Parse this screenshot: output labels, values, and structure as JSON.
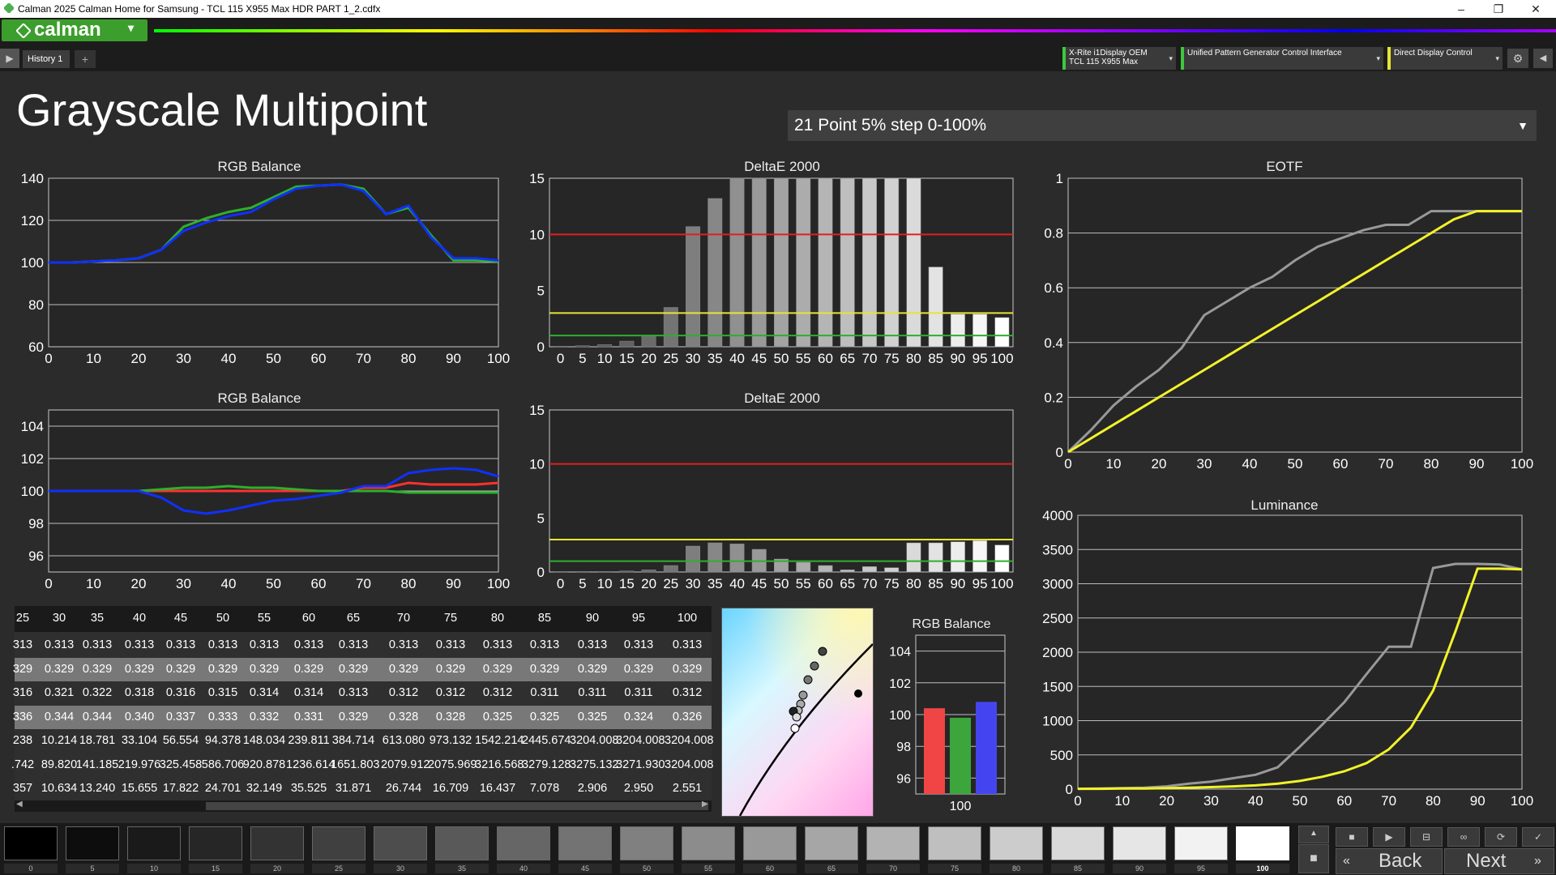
{
  "window": {
    "title": "Calman 2025 Calman Home for Samsung  - TCL 115 X955 Max HDR PART 1_2.cdfx",
    "min": "–",
    "max": "❐",
    "close": "✕"
  },
  "app": {
    "logo": "calman"
  },
  "tabs": [
    {
      "label": "History 1"
    }
  ],
  "devices": {
    "meter": {
      "line1": "X-Rite i1Display OEM",
      "line2": "TCL 115 X955 Max"
    },
    "generator": {
      "label": "Unified Pattern Generator Control Interface"
    },
    "display": {
      "label": "Direct Display Control"
    }
  },
  "page": {
    "title": "Grayscale Multipoint",
    "preset": "21 Point 5% step 0-100%"
  },
  "charts": {
    "rgb_top": "RGB Balance",
    "de_top": "DeltaE 2000",
    "rgb_bottom": "RGB Balance",
    "de_bottom": "DeltaE 2000",
    "eotf": "EOTF",
    "lum": "Luminance",
    "rgb_small": "RGB Balance"
  },
  "chart_data": [
    {
      "type": "line",
      "title": "RGB Balance",
      "x": [
        0,
        5,
        10,
        15,
        20,
        25,
        30,
        35,
        40,
        45,
        50,
        55,
        60,
        65,
        70,
        75,
        80,
        85,
        90,
        95,
        100
      ],
      "ylim": [
        60,
        140
      ],
      "series": [
        {
          "color": "#2cb02c",
          "values": [
            100,
            100,
            100.5,
            101,
            102,
            106,
            117,
            121,
            124,
            126,
            131,
            136,
            136.5,
            137,
            135,
            123,
            126,
            113,
            101,
            101,
            100.5
          ]
        },
        {
          "color": "#1030ff",
          "values": [
            100,
            100,
            100.5,
            101,
            102,
            106,
            115,
            119,
            122,
            124,
            130,
            135,
            136.5,
            137,
            134,
            123,
            127,
            112,
            102,
            102,
            101
          ]
        }
      ]
    },
    {
      "type": "bar",
      "title": "DeltaE 2000",
      "categories": [
        "0",
        "5",
        "10",
        "15",
        "20",
        "25",
        "30",
        "35",
        "40",
        "45",
        "50",
        "55",
        "60",
        "65",
        "70",
        "75",
        "80",
        "85",
        "90",
        "95",
        "100"
      ],
      "ylim": [
        0,
        15
      ],
      "values": [
        0.05,
        0.1,
        0.2,
        0.5,
        1.0,
        3.5,
        10.7,
        13.2,
        15,
        15,
        15,
        15,
        15,
        15,
        15,
        15,
        15,
        7.1,
        2.9,
        2.9,
        2.6
      ],
      "lines": [
        10,
        3,
        1
      ]
    },
    {
      "type": "line",
      "title": "RGB Balance",
      "x": [
        0,
        5,
        10,
        15,
        20,
        25,
        30,
        35,
        40,
        45,
        50,
        55,
        60,
        65,
        70,
        75,
        80,
        85,
        90,
        95,
        100
      ],
      "ylim": [
        95,
        105
      ],
      "series": [
        {
          "color": "#ff3030",
          "values": [
            100,
            100,
            100,
            100,
            100,
            100,
            100,
            100,
            100,
            100,
            100,
            100,
            100,
            100,
            100.2,
            100.2,
            100.5,
            100.4,
            100.4,
            100.4,
            100.5
          ]
        },
        {
          "color": "#2cb02c",
          "values": [
            100,
            100,
            100,
            100,
            100,
            100.1,
            100.2,
            100.2,
            100.3,
            100.2,
            100.2,
            100.1,
            100,
            100,
            100,
            100,
            99.9,
            99.9,
            99.9,
            99.9,
            99.9
          ]
        },
        {
          "color": "#1030ff",
          "values": [
            100,
            100,
            100,
            100,
            100,
            99.6,
            98.8,
            98.6,
            98.8,
            99.1,
            99.4,
            99.5,
            99.7,
            99.9,
            100.3,
            100.3,
            101.1,
            101.3,
            101.4,
            101.3,
            100.9
          ]
        }
      ]
    },
    {
      "type": "bar",
      "title": "DeltaE 2000",
      "categories": [
        "0",
        "5",
        "10",
        "15",
        "20",
        "25",
        "30",
        "35",
        "40",
        "45",
        "50",
        "55",
        "60",
        "65",
        "70",
        "75",
        "80",
        "85",
        "90",
        "95",
        "100"
      ],
      "ylim": [
        0,
        15
      ],
      "values": [
        0.05,
        0.05,
        0.05,
        0.1,
        0.2,
        0.6,
        2.4,
        2.7,
        2.6,
        2.1,
        1.2,
        0.9,
        0.6,
        0.2,
        0.5,
        0.4,
        2.7,
        2.7,
        2.8,
        2.9,
        2.5
      ],
      "lines": [
        10,
        3,
        1
      ]
    },
    {
      "type": "line",
      "title": "EOTF",
      "x": [
        0,
        5,
        10,
        15,
        20,
        25,
        30,
        35,
        40,
        45,
        50,
        55,
        60,
        65,
        70,
        75,
        80,
        85,
        90,
        95,
        100
      ],
      "ylim": [
        0,
        1
      ],
      "series": [
        {
          "color": "#999999",
          "values": [
            0,
            0.08,
            0.17,
            0.24,
            0.3,
            0.38,
            0.5,
            0.55,
            0.6,
            0.64,
            0.7,
            0.75,
            0.78,
            0.81,
            0.83,
            0.83,
            0.88,
            0.88,
            0.88,
            0.88,
            0.88
          ]
        },
        {
          "color": "#f2f22a",
          "values": [
            0,
            0.05,
            0.1,
            0.15,
            0.2,
            0.25,
            0.3,
            0.35,
            0.4,
            0.45,
            0.5,
            0.55,
            0.6,
            0.65,
            0.7,
            0.75,
            0.8,
            0.85,
            0.88,
            0.88,
            0.88
          ]
        }
      ]
    },
    {
      "type": "line",
      "title": "Luminance",
      "x": [
        0,
        5,
        10,
        15,
        20,
        25,
        30,
        35,
        40,
        45,
        50,
        55,
        60,
        65,
        70,
        75,
        80,
        85,
        90,
        95,
        100
      ],
      "ylim": [
        0,
        4000
      ],
      "series": [
        {
          "color": "#999999",
          "values": [
            5,
            10,
            15,
            20,
            40,
            80,
            110,
            160,
            210,
            320,
            620,
            940,
            1270,
            1680,
            2080,
            2080,
            3230,
            3290,
            3290,
            3280,
            3210
          ]
        },
        {
          "color": "#f2f22a",
          "values": [
            5,
            5,
            10,
            10,
            15,
            20,
            30,
            40,
            55,
            80,
            120,
            180,
            260,
            380,
            580,
            900,
            1440,
            2300,
            3220,
            3220,
            3210
          ]
        }
      ]
    },
    {
      "type": "bar",
      "title": "RGB Balance",
      "categories": [
        "100"
      ],
      "ylim": [
        95,
        105
      ],
      "series": [
        {
          "color": "#f04545",
          "values": [
            100.4
          ]
        },
        {
          "color": "#3ca63c",
          "values": [
            99.8
          ]
        },
        {
          "color": "#4545f0",
          "values": [
            100.8
          ]
        }
      ]
    }
  ],
  "table": {
    "headers": [
      "25",
      "30",
      "35",
      "40",
      "45",
      "50",
      "55",
      "60",
      "65",
      "70",
      "75",
      "80",
      "85",
      "90",
      "95",
      "100"
    ],
    "rows": [
      [
        "313",
        "0.313",
        "0.313",
        "0.313",
        "0.313",
        "0.313",
        "0.313",
        "0.313",
        "0.313",
        "0.313",
        "0.313",
        "0.313",
        "0.313",
        "0.313",
        "0.313",
        "0.313"
      ],
      [
        "329",
        "0.329",
        "0.329",
        "0.329",
        "0.329",
        "0.329",
        "0.329",
        "0.329",
        "0.329",
        "0.329",
        "0.329",
        "0.329",
        "0.329",
        "0.329",
        "0.329",
        "0.329"
      ],
      [
        "316",
        "0.321",
        "0.322",
        "0.318",
        "0.316",
        "0.315",
        "0.314",
        "0.314",
        "0.313",
        "0.312",
        "0.312",
        "0.312",
        "0.311",
        "0.311",
        "0.311",
        "0.312"
      ],
      [
        "336",
        "0.344",
        "0.344",
        "0.340",
        "0.337",
        "0.333",
        "0.332",
        "0.331",
        "0.329",
        "0.328",
        "0.328",
        "0.325",
        "0.325",
        "0.325",
        "0.324",
        "0.326"
      ],
      [
        "238",
        "10.214",
        "18.781",
        "33.104",
        "56.554",
        "94.378",
        "148.034",
        "239.811",
        "384.714",
        "613.080",
        "973.132",
        "1542.214",
        "2445.674",
        "3204.008",
        "3204.008",
        "3204.008"
      ],
      [
        ".742",
        "89.820",
        "141.185",
        "219.976",
        "325.458",
        "586.706",
        "920.878",
        "1236.614",
        "1651.803",
        "2079.912",
        "2075.969",
        "3216.568",
        "3279.128",
        "3275.132",
        "3271.930",
        "3204.008"
      ],
      [
        "357",
        "10.634",
        "13.240",
        "15.655",
        "17.822",
        "24.701",
        "32.149",
        "35.525",
        "31.871",
        "26.744",
        "16.709",
        "16.437",
        "7.078",
        "2.906",
        "2.950",
        "2.551"
      ]
    ]
  },
  "swatches": [
    "0",
    "5",
    "10",
    "15",
    "20",
    "25",
    "30",
    "35",
    "40",
    "45",
    "50",
    "55",
    "60",
    "65",
    "70",
    "75",
    "80",
    "85",
    "90",
    "95",
    "100"
  ],
  "nav": {
    "back": "Back",
    "next": "Next"
  }
}
